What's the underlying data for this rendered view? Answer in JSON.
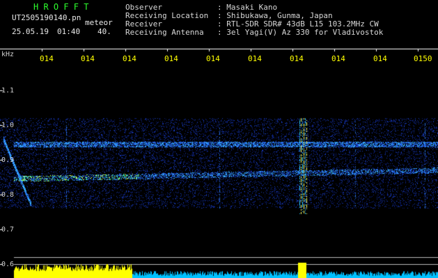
{
  "app": {
    "title": "H R O F F T",
    "filename": "UT2505190140.pn",
    "type_label": "meteor",
    "date": "25.05.19",
    "time": "01:40",
    "count": "40."
  },
  "header": {
    "observer_label": "Observer",
    "observer_value": ": Masaki Kano",
    "location_label": "Receiving Location",
    "location_value": ": Shibukawa, Gunma, Japan",
    "receiver_label": "Receiver",
    "receiver_value": ": RTL-SDR SDR# 43dB L15 103.2MHz CW",
    "antenna_label": "Receiving Antenna",
    "antenna_value": ": 3el Yagi(V) Az 330 for Vladivostok"
  },
  "axes": {
    "y_unit": "kHz",
    "x_ticks": [
      "014",
      "014",
      "014",
      "014",
      "014",
      "014",
      "014",
      "014",
      "014",
      "0150"
    ],
    "y_ticks": [
      "1.1",
      "1.0",
      "0.9",
      "0.8",
      "0.7",
      "0.6"
    ]
  },
  "colors": {
    "background": "#000000",
    "title": "#2dff2d",
    "tick_x": "#ffff00",
    "signal_low": "#1030a0",
    "signal_mid": "#20a0ff",
    "signal_high": "#ffff40"
  }
}
